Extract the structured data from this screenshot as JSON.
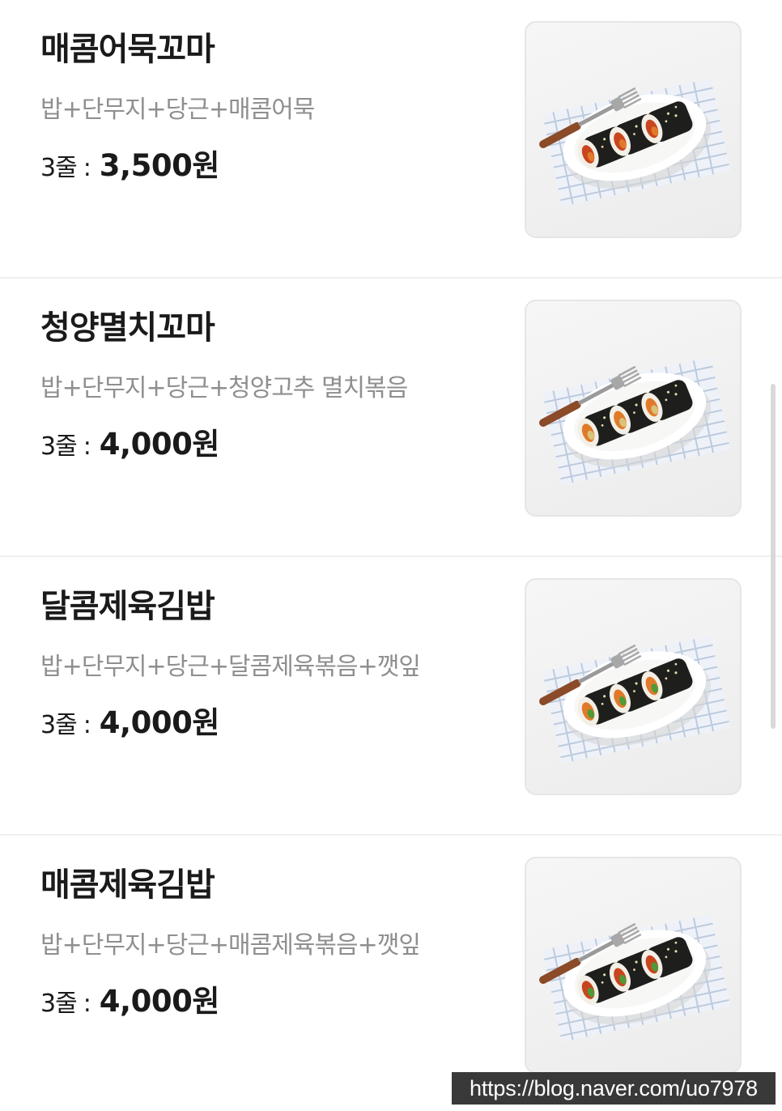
{
  "menu": {
    "items": [
      {
        "name": "매콤어묵꼬마",
        "ingredients": "밥+단무지+당근+매콤어묵",
        "price_unit": "3줄",
        "price_separator": ":",
        "price": "3,500원",
        "image": "spicy-fishcake-kimbap-photo"
      },
      {
        "name": "청양멸치꼬마",
        "ingredients": "밥+단무지+당근+청양고추 멸치볶음",
        "price_unit": "3줄",
        "price_separator": ":",
        "price": "4,000원",
        "image": "cheongyang-anchovy-kimbap-photo"
      },
      {
        "name": "달콤제육김밥",
        "ingredients": "밥+단무지+당근+달콤제육볶음+깻잎",
        "price_unit": "3줄",
        "price_separator": ":",
        "price": "4,000원",
        "image": "sweet-pork-kimbap-photo"
      },
      {
        "name": "매콤제육김밥",
        "ingredients": "밥+단무지+당근+매콤제육볶음+깻잎",
        "price_unit": "3줄",
        "price_separator": ":",
        "price": "4,000원",
        "image": "spicy-pork-kimbap-photo"
      }
    ]
  },
  "watermark": {
    "text": "https://blog.naver.com/uo7978"
  },
  "colors": {
    "title": "#1a1a1a",
    "description": "#8f8f8f",
    "divider": "#efefef",
    "plate": "#ffffff",
    "seaweed": "#1e1f1c",
    "filling_red": "#c9451f",
    "filling_orange": "#e07a2a",
    "perilla_green": "#4f9a36",
    "cloth_blue": "#b7c6dc",
    "fork_handle": "#8b4a28"
  }
}
